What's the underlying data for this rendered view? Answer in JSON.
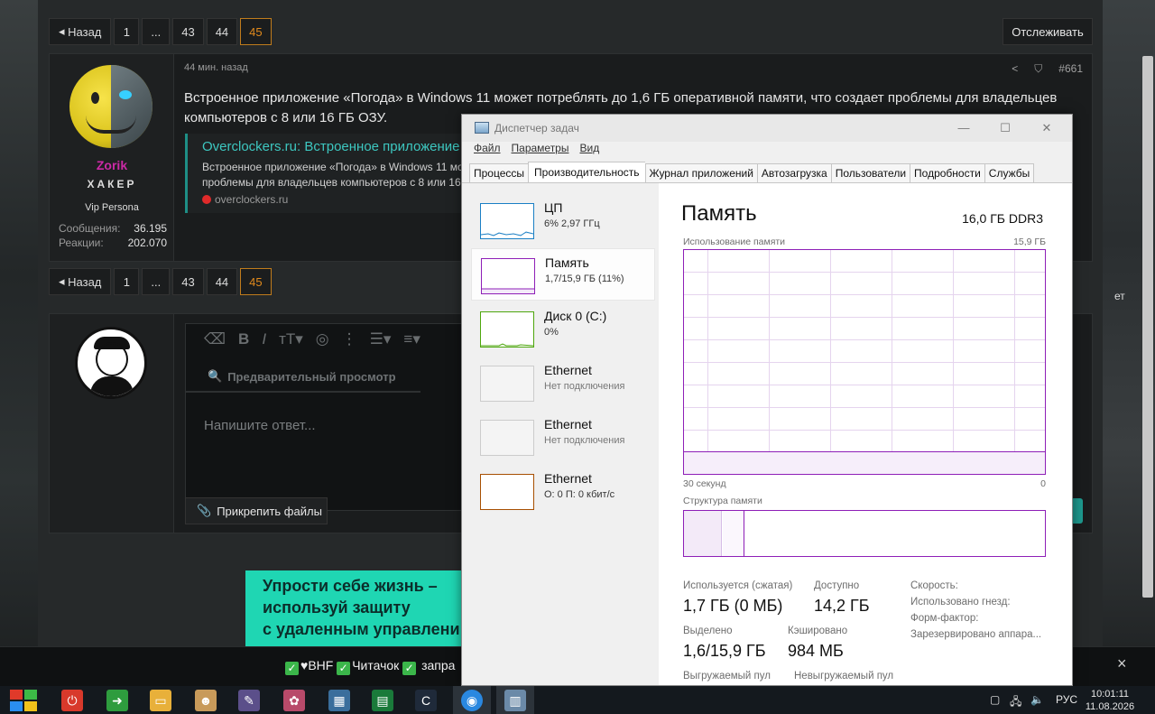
{
  "forum": {
    "pager_top": {
      "back": "Назад",
      "pages": [
        "1",
        "...",
        "43",
        "44",
        "45"
      ]
    },
    "pager_bottom": {
      "back": "Назад",
      "pages": [
        "1",
        "...",
        "43",
        "44",
        "45"
      ]
    },
    "follow_label": "Отслеживать",
    "post": {
      "author": "Zorik",
      "title": "ХАКЕР",
      "rank": "Vip Persona",
      "stats": [
        {
          "label": "Сообщения:",
          "value": "36.195"
        },
        {
          "label": "Реакции:",
          "value": "202.070"
        }
      ],
      "time": "44 мин. назад",
      "number": "#661",
      "text": "Встроенное приложение «Погода» в Windows 11 может потреблять до 1,6 ГБ оперативной памяти, что создает проблемы для владельцев компьютеров с 8 или 16 ГБ ОЗУ.",
      "quote": {
        "title": "Overclockers.ru: Встроенное приложение «",
        "line1": "Встроенное приложение «Погода» в Windows 11 мо",
        "line2": "проблемы для владельцев компьютеров с 8 или 16",
        "source": "overclockers.ru"
      },
      "stray_text": "ет"
    },
    "reply": {
      "preview_label": "Предварительный просмотр",
      "placeholder": "Напишите ответ...",
      "attach_label": "Прикрепить файлы"
    },
    "ad": {
      "lines": [
        "Упрости себе жизнь –",
        "используй защиту",
        "с удаленным управлени"
      ]
    },
    "notice": {
      "items": [
        "♥BHF",
        "Читачок",
        "запра"
      ],
      "close": "×"
    }
  },
  "taskmgr": {
    "title": "Диспетчер задач",
    "window_buttons": [
      "—",
      "☐",
      "✕"
    ],
    "menu": [
      "Файл",
      "Параметры",
      "Вид"
    ],
    "tabs": [
      "Процессы",
      "Производительность",
      "Журнал приложений",
      "Автозагрузка",
      "Пользователи",
      "Подробности",
      "Службы"
    ],
    "active_tab": "Производительность",
    "resources": [
      {
        "name": "ЦП",
        "sub": "6% 2,97 ГГц",
        "color": "#1a7fc4"
      },
      {
        "name": "Память",
        "sub": "1,7/15,9 ГБ (11%)",
        "color": "#8e1fb7"
      },
      {
        "name": "Диск 0 (C:)",
        "sub": "0%",
        "color": "#4da60c"
      },
      {
        "name": "Ethernet",
        "sub": "Нет подключения",
        "color": "#cccccc"
      },
      {
        "name": "Ethernet",
        "sub": "Нет подключения",
        "color": "#cccccc"
      },
      {
        "name": "Ethernet",
        "sub": "О: 0 П: 0 кбит/с",
        "color": "#a74f01"
      }
    ],
    "memory": {
      "title": "Память",
      "spec": "16,0 ГБ DDR3",
      "usage_label": "Использование памяти",
      "usage_max": "15,9 ГБ",
      "time_left": "30 секунд",
      "time_right": "0",
      "structure_label": "Структура памяти",
      "stats": {
        "in_use_label": "Используется (сжатая)",
        "in_use": "1,7 ГБ (0 МБ)",
        "available_label": "Доступно",
        "available": "14,2 ГБ",
        "committed_label": "Выделено",
        "committed": "1,6/15,9 ГБ",
        "cached_label": "Кэшировано",
        "cached": "984 МБ",
        "paged_label": "Выгружаемый пул",
        "nonpaged_label": "Невыгружаемый пул",
        "speed_label": "Скорость:",
        "slots_label": "Использовано гнезд:",
        "form_label": "Форм-фактор:",
        "reserved_label": "Зарезервировано аппара..."
      }
    }
  },
  "taskbar": {
    "lang": "РУС",
    "time": "10:01:11",
    "date": "11.08.2026"
  }
}
